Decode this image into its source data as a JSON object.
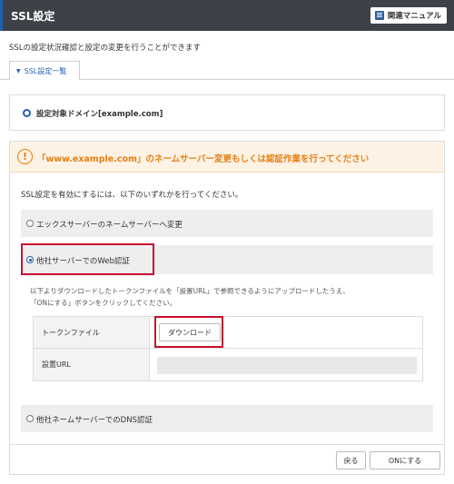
{
  "header": {
    "title": "SSL設定",
    "manual_label": "関連マニュアル",
    "accent_color": "#1f5fb0",
    "bg_color": "#3d4148"
  },
  "description": "SSLの設定状況確認と設定の変更を行うことができます",
  "tabs": [
    {
      "label": "SSL設定一覧",
      "icon": "chevron-down-icon",
      "active": true
    }
  ],
  "domain": {
    "label": "設定対象ドメイン[example.com]"
  },
  "warning": {
    "icon": "exclamation-circle-icon",
    "text": "「www.example.com」のネームサーバー変更もしくは認証作業を行ってください",
    "color": "#e67e14"
  },
  "instruction": "SSL設定を有効にするには、以下のいずれかを行ってください。",
  "options": [
    {
      "label": "エックスサーバーのネームサーバーへ変更",
      "selected": false
    },
    {
      "label": "他社サーバーでのWeb認証",
      "selected": true
    },
    {
      "label": "他社ネームサーバーでのDNS認証",
      "selected": false
    }
  ],
  "web_auth": {
    "desc_line1": "以下よりダウンロードしたトークンファイルを「設置URL」で参照できるようにアップロードしたうえ、",
    "desc_line2": "「ONにする」ボタンをクリックしてください。",
    "token_label": "トークンファイル",
    "download_label": "ダウンロード",
    "url_label": "設置URL",
    "url_value": ""
  },
  "footer": {
    "back_label": "戻る",
    "on_label": "ONにする"
  }
}
